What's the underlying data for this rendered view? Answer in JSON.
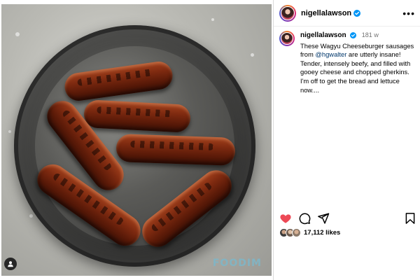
{
  "post": {
    "username": "nigellalawson",
    "time_ago": "181 w",
    "caption_before_mention": "These Wagyu Cheeseburger sausages from ",
    "mention": "@hgwalter",
    "caption_after_mention": " are utterly insane! Tender, intensely beefy, and filled with gooey cheese and chopped gherkins. I'm off to get the bread and lettuce now....",
    "likes_text": "17,112 likes",
    "watermark": "FOODIM"
  },
  "colors": {
    "like_active": "#ed4956",
    "verified": "#0095f6",
    "mention": "#00376b"
  },
  "icons": {
    "like": "heart-icon",
    "comment": "comment-icon",
    "share": "share-icon",
    "save": "bookmark-icon",
    "more": "more-options-icon",
    "verified": "verified-badge-icon",
    "tagged": "user-tag-icon"
  }
}
